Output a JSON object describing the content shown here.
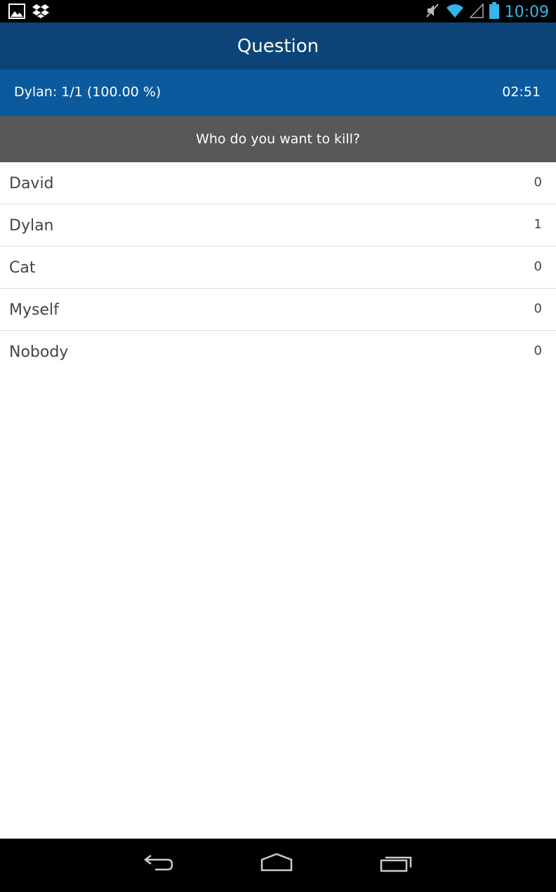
{
  "status_bar": {
    "time": "10:09",
    "time_color": "#33b5e5",
    "left_icons": [
      "gallery-icon",
      "dropbox-icon"
    ],
    "right_icons": [
      "mute-icon",
      "wifi-icon",
      "signal-icon",
      "battery-icon"
    ]
  },
  "header": {
    "title": "Question",
    "background": "#0d4478"
  },
  "score_bar": {
    "score_text": "Dylan: 1/1 (100.00 %)",
    "timer": "02:51",
    "background": "#0b5a9e"
  },
  "question": {
    "text": "Who do you want to kill?",
    "background": "#585858"
  },
  "answers": [
    {
      "label": "David",
      "count": "0"
    },
    {
      "label": "Dylan",
      "count": "1"
    },
    {
      "label": "Cat",
      "count": "0"
    },
    {
      "label": "Myself",
      "count": "0"
    },
    {
      "label": "Nobody",
      "count": "0"
    }
  ],
  "nav_bar": {
    "buttons": [
      "back-icon",
      "home-icon",
      "recent-apps-icon"
    ]
  }
}
